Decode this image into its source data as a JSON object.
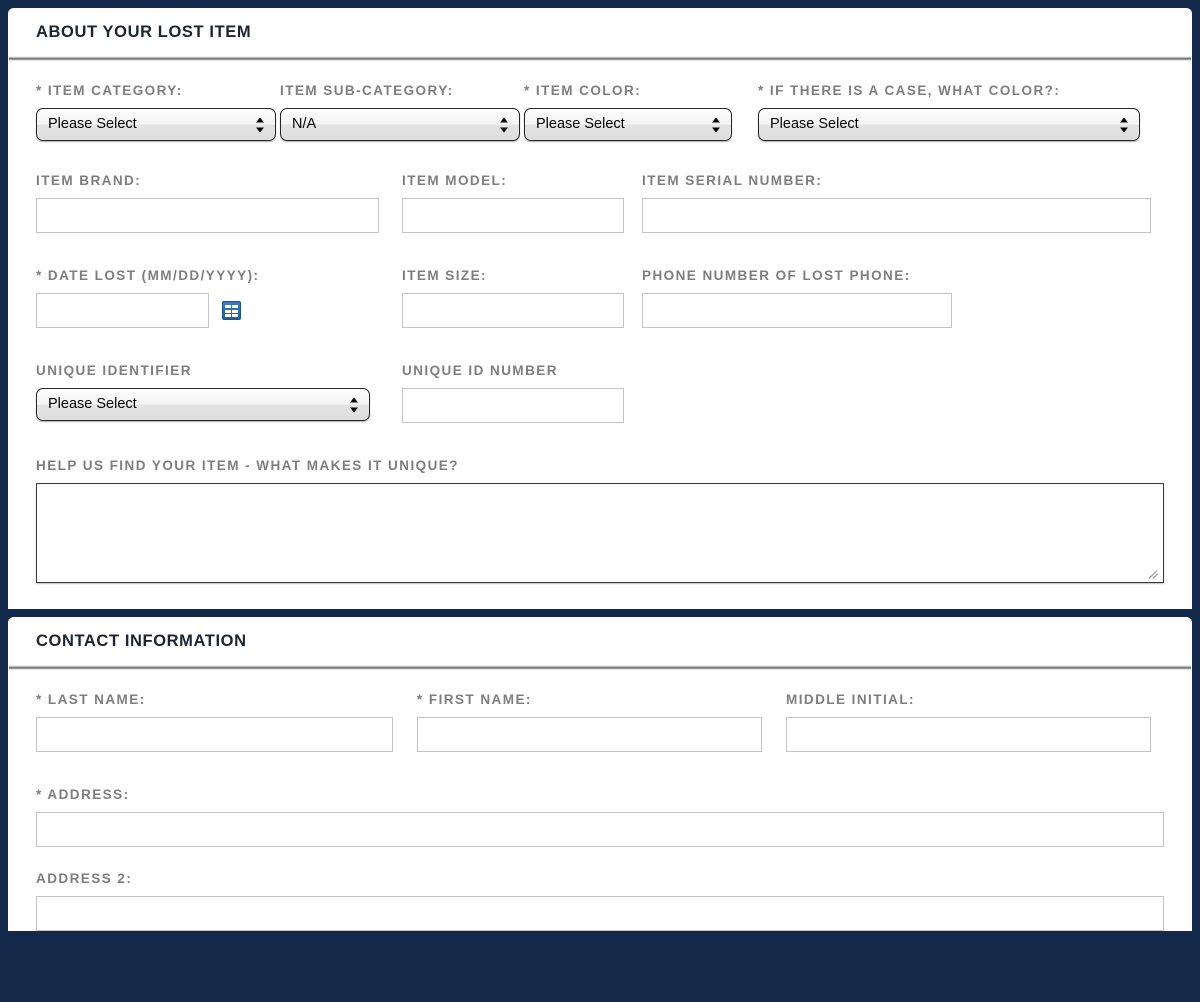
{
  "theme": {
    "page_background": "#12294a",
    "panel_background": "#ffffff",
    "label_color": "#7e7e7e",
    "title_color": "#1b2431",
    "input_border": "#c4c4c4",
    "calendar_icon_color": "#2f6fae"
  },
  "panels": [
    {
      "id": "about-lost-item",
      "title": "ABOUT YOUR LOST ITEM",
      "fields": {
        "item_category": {
          "label": "* ITEM CATEGORY:",
          "value": "Please Select",
          "type": "select"
        },
        "item_subcategory": {
          "label": "ITEM SUB-CATEGORY:",
          "value": "N/A",
          "type": "select"
        },
        "item_color": {
          "label": "* ITEM COLOR:",
          "value": "Please Select",
          "type": "select"
        },
        "case_color": {
          "label": "* IF THERE IS A CASE, WHAT COLOR?:",
          "value": "Please Select",
          "type": "select"
        },
        "item_brand": {
          "label": "ITEM BRAND:",
          "value": "",
          "placeholder": "",
          "type": "text"
        },
        "item_model": {
          "label": "ITEM MODEL:",
          "value": "",
          "placeholder": "",
          "type": "text"
        },
        "item_serial": {
          "label": "ITEM SERIAL NUMBER:",
          "value": "",
          "placeholder": "",
          "type": "text"
        },
        "date_lost": {
          "label": "* DATE LOST (MM/DD/YYYY):",
          "value": "",
          "placeholder": "",
          "type": "text",
          "icon": "calendar-icon"
        },
        "item_size": {
          "label": "ITEM SIZE:",
          "value": "",
          "placeholder": "",
          "type": "text"
        },
        "phone_number": {
          "label": "PHONE NUMBER OF LOST PHONE:",
          "value": "",
          "placeholder": "",
          "type": "text"
        },
        "unique_identifier": {
          "label": "UNIQUE IDENTIFIER",
          "value": "Please Select",
          "type": "select"
        },
        "unique_id_number": {
          "label": "UNIQUE ID NUMBER",
          "value": "",
          "placeholder": "",
          "type": "text"
        },
        "unique_details": {
          "label": "HELP US FIND YOUR ITEM - WHAT MAKES IT UNIQUE?",
          "value": "",
          "placeholder": "",
          "type": "textarea"
        }
      }
    },
    {
      "id": "contact-information",
      "title": "CONTACT INFORMATION",
      "fields": {
        "last_name": {
          "label": "* LAST NAME:",
          "value": "",
          "placeholder": "",
          "type": "text"
        },
        "first_name": {
          "label": "* FIRST NAME:",
          "value": "",
          "placeholder": "",
          "type": "text"
        },
        "middle_initial": {
          "label": "MIDDLE INITIAL:",
          "value": "",
          "placeholder": "",
          "type": "text"
        },
        "address": {
          "label": "* ADDRESS:",
          "value": "",
          "placeholder": "",
          "type": "text"
        },
        "address2": {
          "label": "ADDRESS 2:",
          "value": "",
          "placeholder": "",
          "type": "text"
        }
      }
    }
  ]
}
